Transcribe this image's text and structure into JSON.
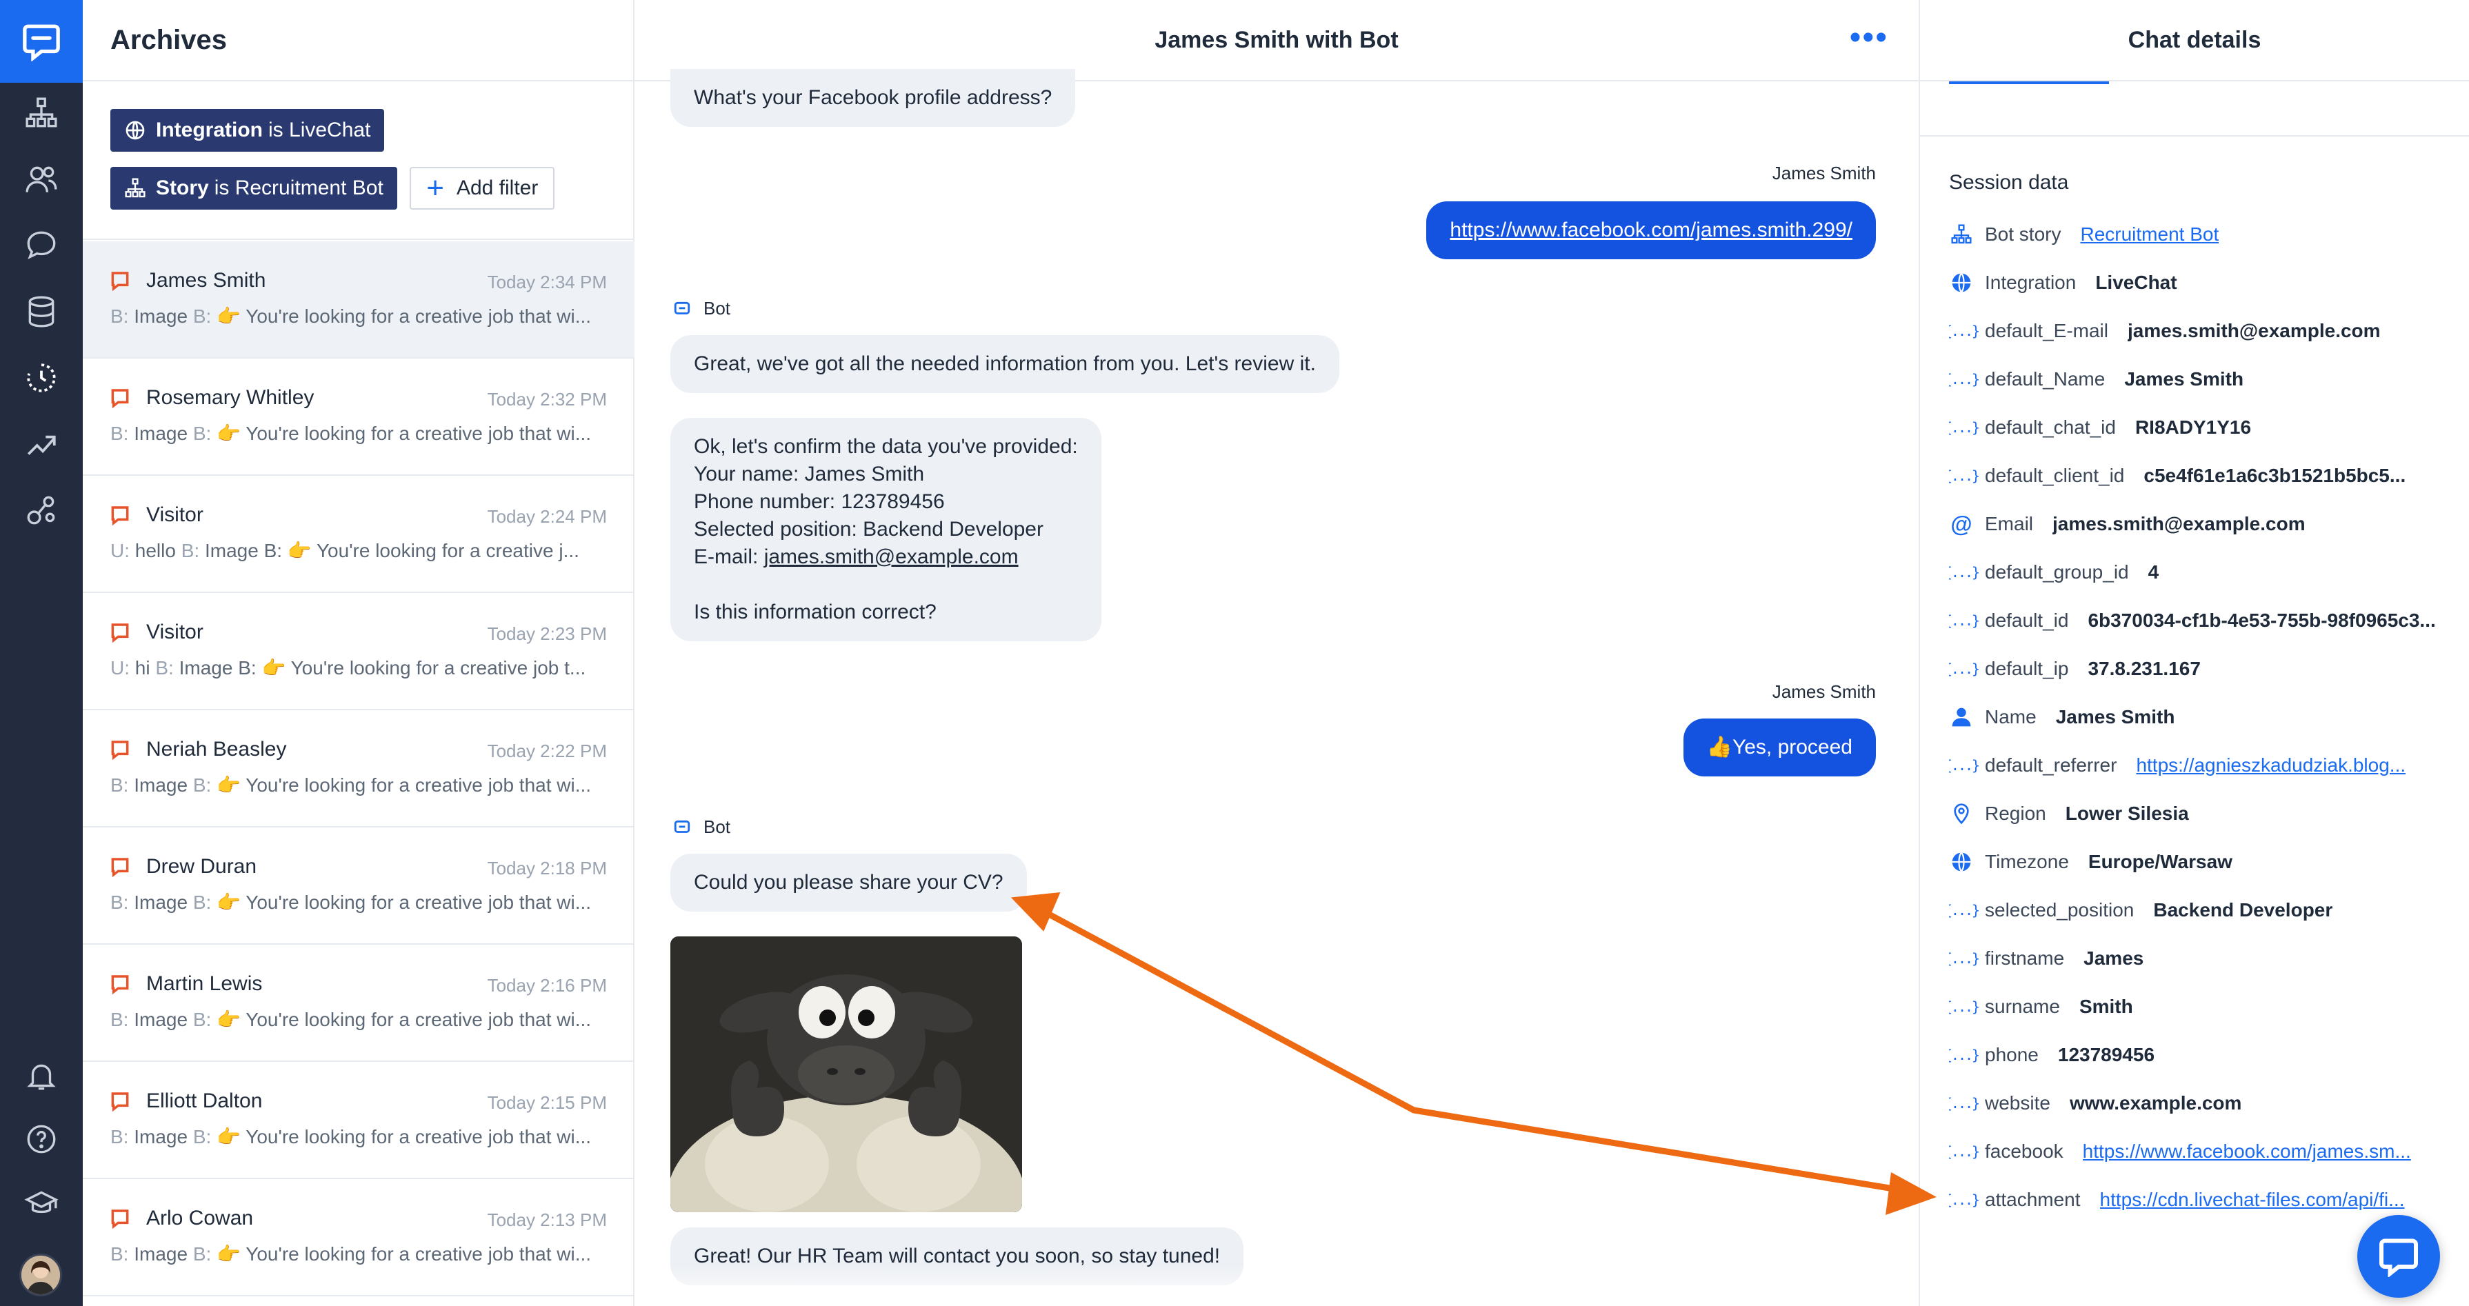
{
  "archives": {
    "title": "Archives",
    "filters": [
      {
        "key": "Integration",
        "connector": "is",
        "value": "LiveChat"
      },
      {
        "key": "Story",
        "connector": "is",
        "value": "Recruitment Bot"
      }
    ],
    "add_filter_label": "Add filter",
    "conversations": [
      {
        "name": "James Smith",
        "time": "Today 2:34 PM",
        "preview": [
          "B:",
          " Image ",
          "B:",
          " 👉 You're looking for a creative job that wi..."
        ]
      },
      {
        "name": "Rosemary Whitley",
        "time": "Today 2:32 PM",
        "preview": [
          "B:",
          " Image ",
          "B:",
          " 👉 You're looking for a creative job that wi..."
        ]
      },
      {
        "name": "Visitor",
        "time": "Today 2:24 PM",
        "preview": [
          "U:",
          " hello ",
          "B:",
          " Image B: 👉 You're looking for a creative j..."
        ]
      },
      {
        "name": "Visitor",
        "time": "Today 2:23 PM",
        "preview": [
          "U:",
          " hi ",
          "B:",
          " Image B: 👉 You're looking for a creative job t..."
        ]
      },
      {
        "name": "Neriah Beasley",
        "time": "Today 2:22 PM",
        "preview": [
          "B:",
          " Image ",
          "B:",
          " 👉 You're looking for a creative job that wi..."
        ]
      },
      {
        "name": "Drew Duran",
        "time": "Today 2:18 PM",
        "preview": [
          "B:",
          " Image ",
          "B:",
          " 👉 You're looking for a creative job that wi..."
        ]
      },
      {
        "name": "Martin Lewis",
        "time": "Today 2:16 PM",
        "preview": [
          "B:",
          " Image ",
          "B:",
          " 👉 You're looking for a creative job that wi..."
        ]
      },
      {
        "name": "Elliott Dalton",
        "time": "Today 2:15 PM",
        "preview": [
          "B:",
          " Image ",
          "B:",
          " 👉 You're looking for a creative job that wi..."
        ]
      },
      {
        "name": "Arlo Cowan",
        "time": "Today 2:13 PM",
        "preview": [
          "B:",
          " Image ",
          "B:",
          " 👉 You're looking for a creative job that wi..."
        ]
      }
    ]
  },
  "chat": {
    "title": "James Smith with Bot",
    "msg_facebook_q": "What's your Facebook profile address?",
    "sender_user": "James Smith",
    "msg_facebook_a": "https://www.facebook.com/james.smith.299/",
    "sender_bot": "Bot",
    "msg_review": "Great, we've got all the needed information from you. Let's review it.",
    "confirm": {
      "line1": "Ok, let's confirm the data you've provided:",
      "line2": "Your name: James Smith",
      "line3": "Phone number: 123789456",
      "line4": "Selected position: Backend Developer",
      "email_label": "E-mail: ",
      "email_value": "james.smith@example.com",
      "line6": "Is this information correct?"
    },
    "msg_proceed": "👍Yes, proceed",
    "msg_cv": "Could you please share your CV?",
    "msg_final": "Great! Our HR Team will contact you soon, so stay tuned!"
  },
  "details": {
    "title": "Chat details",
    "session_title": "Session data",
    "rows": [
      {
        "icon": "bot-story-icon",
        "key": "Bot story",
        "value": "Recruitment Bot",
        "link": true
      },
      {
        "icon": "globe-icon",
        "key": "Integration",
        "value": "LiveChat",
        "link": false
      },
      {
        "icon": "variable-icon",
        "key": "default_E-mail",
        "value": "james.smith@example.com",
        "link": false
      },
      {
        "icon": "variable-icon",
        "key": "default_Name",
        "value": "James Smith",
        "link": false
      },
      {
        "icon": "variable-icon",
        "key": "default_chat_id",
        "value": "RI8ADY1Y16",
        "link": false
      },
      {
        "icon": "variable-icon",
        "key": "default_client_id",
        "value": "c5e4f61e1a6c3b1521b5bc5...",
        "link": false
      },
      {
        "icon": "at-icon",
        "key": "Email",
        "value": "james.smith@example.com",
        "link": false
      },
      {
        "icon": "variable-icon",
        "key": "default_group_id",
        "value": "4",
        "link": false
      },
      {
        "icon": "variable-icon",
        "key": "default_id",
        "value": "6b370034-cf1b-4e53-755b-98f0965c3...",
        "link": false
      },
      {
        "icon": "variable-icon",
        "key": "default_ip",
        "value": "37.8.231.167",
        "link": false
      },
      {
        "icon": "person-icon",
        "key": "Name",
        "value": "James Smith",
        "link": false
      },
      {
        "icon": "variable-icon",
        "key": "default_referrer",
        "value": "https://agnieszkadudziak.blog...",
        "link": true
      },
      {
        "icon": "location-pin-icon",
        "key": "Region",
        "value": "Lower Silesia",
        "link": false
      },
      {
        "icon": "globe-icon",
        "key": "Timezone",
        "value": "Europe/Warsaw",
        "link": false
      },
      {
        "icon": "variable-icon",
        "key": "selected_position",
        "value": "Backend Developer",
        "link": false
      },
      {
        "icon": "variable-icon",
        "key": "firstname",
        "value": "James",
        "link": false
      },
      {
        "icon": "variable-icon",
        "key": "surname",
        "value": "Smith",
        "link": false
      },
      {
        "icon": "variable-icon",
        "key": "phone",
        "value": "123789456",
        "link": false
      },
      {
        "icon": "variable-icon",
        "key": "website",
        "value": "www.example.com",
        "link": false
      },
      {
        "icon": "variable-icon",
        "key": "facebook",
        "value": "https://www.facebook.com/james.sm...",
        "link": true
      },
      {
        "icon": "variable-icon",
        "key": "attachment",
        "value": "https://cdn.livechat-files.com/api/fi...",
        "link": true
      }
    ]
  },
  "colors": {
    "nav_bg": "#232b3e",
    "accent": "#1a6bf0",
    "user_bubble": "#1452e0",
    "bot_bubble": "#edf0f4",
    "filter_chip": "#2a3a70",
    "annotation_arrow": "#ee6a12",
    "conversation_icon": "#e8542a"
  }
}
